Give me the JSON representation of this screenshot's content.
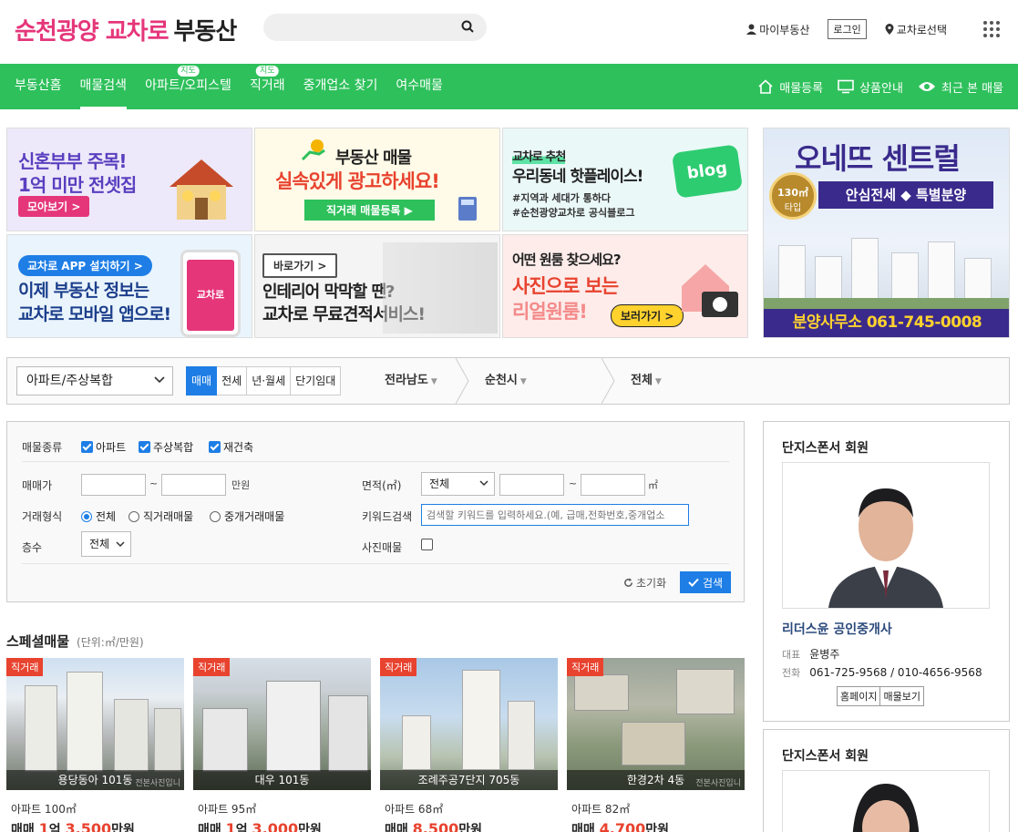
{
  "header": {
    "logo_main": "순천광양 교차로",
    "logo_sub": "부동산",
    "search_placeholder": "",
    "my_estate": "마이부동산",
    "login": "로그인",
    "region_select": "교차로선택"
  },
  "nav": {
    "items": [
      {
        "label": "부동산홈",
        "badge": ""
      },
      {
        "label": "매물검색",
        "badge": ""
      },
      {
        "label": "아파트/오피스텔",
        "badge": "지도"
      },
      {
        "label": "직거래",
        "badge": "지도"
      },
      {
        "label": "중개업소 찾기",
        "badge": ""
      },
      {
        "label": "여수매물",
        "badge": ""
      }
    ],
    "right": [
      "매물등록",
      "상품안내",
      "최근 본 매물"
    ]
  },
  "banners": {
    "b1": {
      "line1": "신혼부부 주목!",
      "line2": "1억 미만 전셋집",
      "btn": "모아보기 >"
    },
    "b2": {
      "line1": "부동산 매물",
      "line2": "실속있게 광고하세요!",
      "btn": "직거래 매물등록 ▶"
    },
    "b3": {
      "line1": "교차로 추천",
      "line2": "우리동네 핫플레이스!",
      "line3": "#지역과 세대가 통하다",
      "line4": "#순천광양교차로 공식블로그",
      "blog": "blog"
    },
    "b4": {
      "pill": "교차로 APP 설치하기 >",
      "line1": "이제 부동산 정보는",
      "line2": "교차로 모바일 앱으로!",
      "app": "교차로"
    },
    "b5": {
      "pill": "바로가기 >",
      "line1": "인테리어 막막할 땐?",
      "line2": "교차로 무료견적서비스!"
    },
    "b6": {
      "line1": "어떤 원룸 찾으세요?",
      "line2": "사진으로 보는",
      "line3": "리얼원룸!",
      "btn": "보러가기 >"
    },
    "b7": {
      "title": "오네뜨 센트럴",
      "sub": "안심전세 ◆ 특별분양",
      "badge_top": "130㎡",
      "badge_bot": "타입",
      "phone": "분양사무소 061-745-0008"
    }
  },
  "filter": {
    "type": "아파트/주상복합",
    "deal_tabs": [
      "매매",
      "전세",
      "년·월세",
      "단기임대"
    ],
    "regions": [
      "전라남도",
      "순천시",
      "전체"
    ]
  },
  "form": {
    "kind_label": "매물종류",
    "kinds": [
      "아파트",
      "주상복합",
      "재건축"
    ],
    "price_label": "매매가",
    "price_unit": "만원",
    "tilde": "~",
    "area_label": "면적(㎡)",
    "area_select": "전체",
    "area_unit": "㎡",
    "deal_label": "거래형식",
    "deals": [
      "전체",
      "직거래매물",
      "중개거래매물"
    ],
    "keyword_label": "키워드검색",
    "keyword_placeholder": "검색할 키워드를 입력하세요.(예, 급매,전화번호,중개업소",
    "floor_label": "층수",
    "floor_select": "전체",
    "photo_label": "사진매물",
    "reset": "초기화",
    "search": "검색"
  },
  "special": {
    "title": "스페셜매물",
    "unit": "(단위:㎡/만원)",
    "cards": [
      {
        "badge": "직거래",
        "name": "용당동아 101동",
        "spec": "아파트 100㎡",
        "deal": "매매",
        "price_a": "1",
        "unit_a": "억",
        "price_b": "3,500",
        "unit_b": "만원",
        "watermark": "전본사진입니"
      },
      {
        "badge": "직거래",
        "name": "대우 101동",
        "spec": "아파트 95㎡",
        "deal": "매매",
        "price_a": "1",
        "unit_a": "억",
        "price_b": "3,000",
        "unit_b": "만원",
        "watermark": ""
      },
      {
        "badge": "직거래",
        "name": "조례주공7단지 705동",
        "spec": "아파트 68㎡",
        "deal": "매매",
        "price_a": "",
        "unit_a": "",
        "price_b": "8,500",
        "unit_b": "만원",
        "watermark": ""
      },
      {
        "badge": "직거래",
        "name": "한경2차 4동",
        "spec": "아파트 82㎡",
        "deal": "매매",
        "price_a": "",
        "unit_a": "",
        "price_b": "4,700",
        "unit_b": "만원",
        "watermark": "전본사진입니"
      }
    ]
  },
  "sponsors": [
    {
      "title": "단지스폰서 회원",
      "office": "리더스윤 공인중개사",
      "rep_label": "대표",
      "rep": "윤병주",
      "tel_label": "전화",
      "tel": "061-725-9568 / 010-4656-9568",
      "btn1": "홈페이지",
      "btn2": "매물보기"
    },
    {
      "title": "단지스폰서 회원"
    }
  ],
  "colors": {
    "brand_pink": "#e5367a",
    "nav_green": "#2ec05b",
    "accent_blue": "#1e7ee6",
    "price_red": "#e8432f"
  }
}
